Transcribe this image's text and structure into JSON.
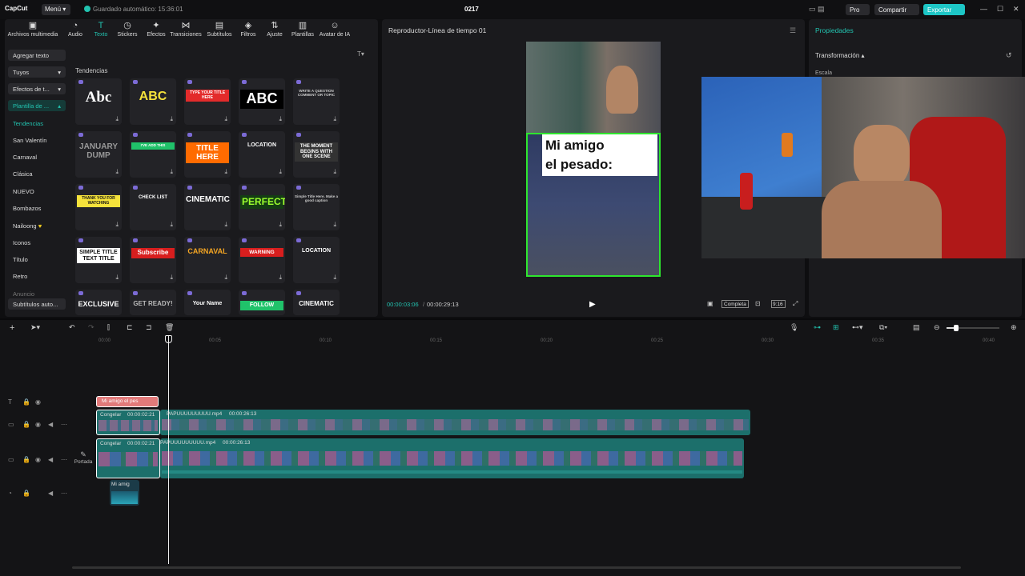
{
  "app": {
    "logo": "CapCut",
    "menu": "Menú",
    "autosave": "Guardado automático: 15:36:01",
    "project": "0217",
    "pro": "Pro",
    "share": "Compartir",
    "export": "Exportar"
  },
  "tabs": [
    {
      "icon": "media-icon",
      "label": "Archivos multimedia"
    },
    {
      "icon": "audio-icon",
      "label": "Audio"
    },
    {
      "icon": "text-icon",
      "label": "Texto"
    },
    {
      "icon": "stickers-icon",
      "label": "Stickers"
    },
    {
      "icon": "effects-icon",
      "label": "Efectos"
    },
    {
      "icon": "transitions-icon",
      "label": "Transiciones"
    },
    {
      "icon": "subtitles-icon",
      "label": "Subtítulos"
    },
    {
      "icon": "filters-icon",
      "label": "Filtros"
    },
    {
      "icon": "adjust-icon",
      "label": "Ajuste"
    },
    {
      "icon": "templates-icon",
      "label": "Plantillas"
    },
    {
      "icon": "ai-avatar-icon",
      "label": "Avatar de IA"
    }
  ],
  "sidebar": [
    "Agregar texto",
    "Tuyos",
    "Efectos de t...",
    "Plantilla de ...",
    "Tendencias",
    "San Valentín",
    "Carnaval",
    "Clásica",
    "NUEVO",
    "Bombazos",
    "Nailoong",
    "Iconos",
    "Título",
    "Retro",
    "Anuncio",
    "Subtítulos auto..."
  ],
  "section": "Tendencias",
  "tiles": [
    "Abc",
    "ABC",
    "TYPE YOUR TITLE HERE",
    "ABC",
    "WRITE A QUESTION COMMENT OR TOPIC",
    "JANUARY DUMP",
    "I'VE ADD THIS",
    "TITLE HERE",
    "LOCATION",
    "THE MOMENT BEGINS WITH ONE SCENE",
    "THANK YOU FOR WATCHING",
    "CHECK LIST",
    "CINEMATIC",
    "PERFECT",
    "Simple Title Here. Make a good caption",
    "SIMPLE TITLE TEXT TITLE",
    "Subscribe",
    "CARNAVAL",
    "WARNING",
    "LOCATION",
    "EXCLUSIVE",
    "GET READY!",
    "Your Name",
    "FOLLOW",
    "CINEMATIC"
  ],
  "preview": {
    "title": "Reproductor-Línea de tiempo 01",
    "caption_line1": "Mi amigo",
    "caption_line2": "el pesado:",
    "time_current": "00:00:03:06",
    "time_total": "00:00:29:13",
    "ratio_label": "Completa",
    "aspect": "9:16"
  },
  "properties": {
    "title": "Propiedades",
    "section": "Transformación",
    "scale": "Escala"
  },
  "ruler": [
    "00:00",
    "00:05",
    "00:10",
    "00:15",
    "00:20",
    "00:25",
    "00:30",
    "00:35",
    "00:40"
  ],
  "clips": {
    "text_clip": "Mi amigo el pes",
    "freeze1": "Congelar",
    "freeze1_time": "00:00:02:21",
    "main1": "PAPUUUUUUUUU.mp4",
    "main1_time": "00:00:26:13",
    "freeze2": "Congelar",
    "freeze2_time": "00:00:02:21",
    "main2": "PAPUUUUUUUUU.mp4",
    "main2_time": "00:00:26:13",
    "audio_clip": "Mi amig",
    "cover": "Portada"
  },
  "colors": {
    "accent": "#22c3b0",
    "clip_teal": "#1c6f6b",
    "text_clip": "#e27a7a"
  }
}
